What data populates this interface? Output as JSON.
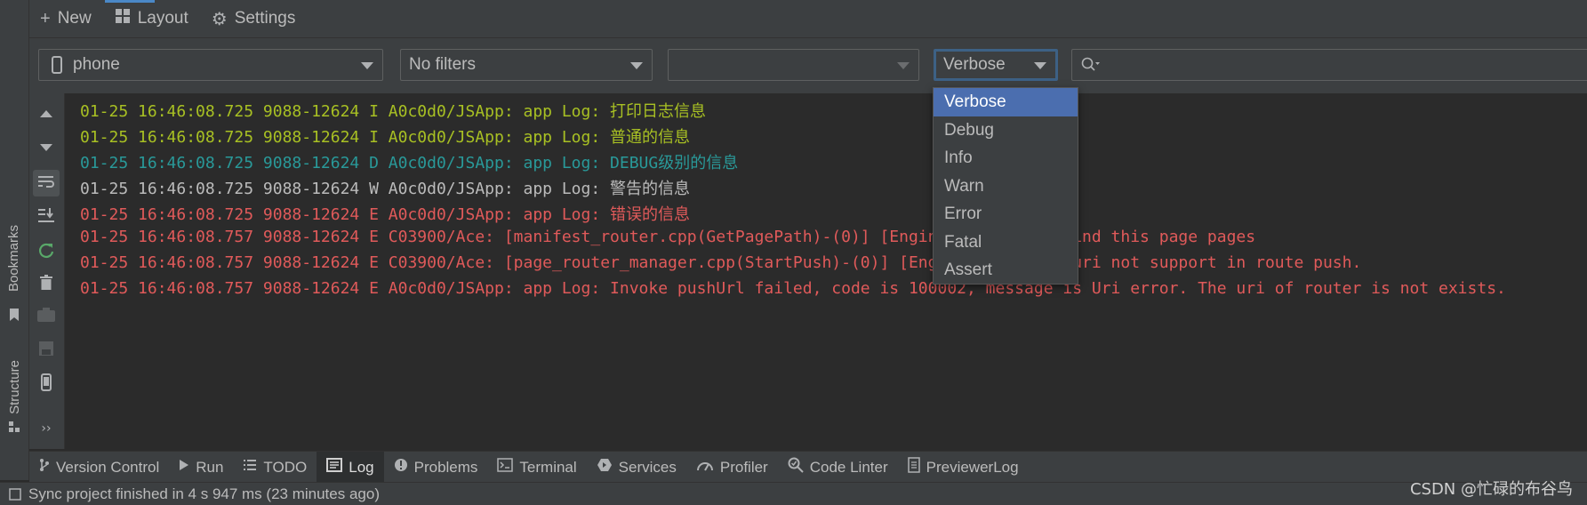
{
  "top_toolbar": {
    "new_label": "New",
    "layout_label": "Layout",
    "settings_label": "Settings"
  },
  "side_tabs": {
    "bookmarks": "Bookmarks",
    "structure": "Structure"
  },
  "filters": {
    "device": "phone",
    "filter": "No filters",
    "process": "",
    "level": "Verbose",
    "search_value": ""
  },
  "level_options": [
    "Verbose",
    "Debug",
    "Info",
    "Warn",
    "Error",
    "Fatal",
    "Assert"
  ],
  "log_lines": [
    {
      "text": "01-25 16:46:08.725 9088-12624 I A0c0d0/JSApp: app Log: 打印日志信息",
      "level": "I"
    },
    {
      "text": "01-25 16:46:08.725 9088-12624 I A0c0d0/JSApp: app Log: 普通的信息",
      "level": "I"
    },
    {
      "text": "01-25 16:46:08.725 9088-12624 D A0c0d0/JSApp: app Log: DEBUG级别的信息",
      "level": "D"
    },
    {
      "text": "01-25 16:46:08.725 9088-12624 W A0c0d0/JSApp: app Log: 警告的信息",
      "level": "W"
    },
    {
      "text": "01-25 16:46:08.725 9088-12624 E A0c0d0/JSApp: app Log: 错误的信息",
      "level": "E"
    },
    {
      "text": "01-25 16:46:08.757 9088-12624 E C03900/Ace: [manifest_router.cpp(GetPagePath)-(0)] [Engine Log] can't find this page pages",
      "level": "E"
    },
    {
      "text": "01-25 16:46:08.757 9088-12624 E C03900/Ace: [page_router_manager.cpp(StartPush)-(0)] [Engine Log] this uri not support in route push.",
      "level": "E"
    },
    {
      "text": "01-25 16:46:08.757 9088-12624 E A0c0d0/JSApp: app Log: Invoke pushUrl failed, code is 100002, message is Uri error. The uri of router is not exists.",
      "level": "E"
    }
  ],
  "level_colors": {
    "I": "#a8c023",
    "D": "#299999",
    "W": "#bbbbbb",
    "E": "#e05a5a"
  },
  "bottom_tabs": [
    {
      "label": "Version Control",
      "icon": "branch-icon"
    },
    {
      "label": "Run",
      "icon": "play-icon"
    },
    {
      "label": "TODO",
      "icon": "list-icon"
    },
    {
      "label": "Log",
      "icon": "log-icon",
      "active": true
    },
    {
      "label": "Problems",
      "icon": "info-icon"
    },
    {
      "label": "Terminal",
      "icon": "terminal-icon"
    },
    {
      "label": "Services",
      "icon": "services-icon"
    },
    {
      "label": "Profiler",
      "icon": "gauge-icon"
    },
    {
      "label": "Code Linter",
      "icon": "linter-icon"
    },
    {
      "label": "PreviewerLog",
      "icon": "doc-icon"
    }
  ],
  "status": {
    "message": "Sync project finished in 4 s 947 ms (23 minutes ago)"
  },
  "watermark": "CSDN @忙碌的布谷鸟"
}
